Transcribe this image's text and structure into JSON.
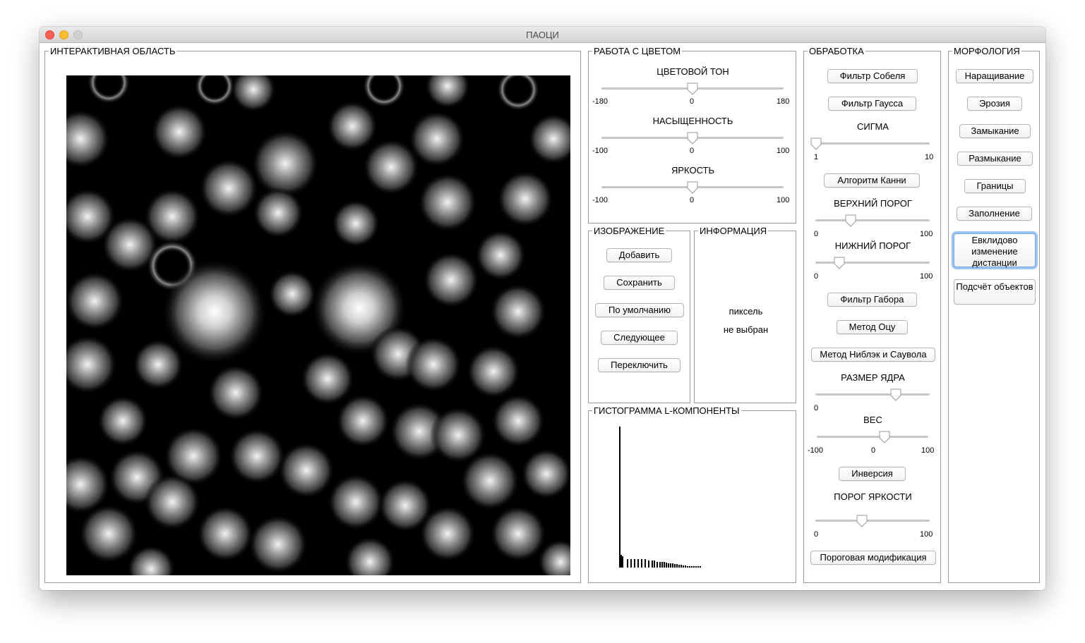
{
  "window": {
    "title": "ПАОЦИ"
  },
  "interactive": {
    "title": "ИНТЕРАКТИВНАЯ ОБЛАСТЬ"
  },
  "color": {
    "title": "РАБОТА С ЦВЕТОМ",
    "hue": {
      "label": "ЦВЕТОВОЙ ТОН",
      "min": "-180",
      "mid": "0",
      "max": "180",
      "value": 0
    },
    "saturation": {
      "label": "НАСЫЩЕННОСТЬ",
      "min": "-100",
      "mid": "0",
      "max": "100",
      "value": 0
    },
    "brightness": {
      "label": "ЯРКОСТЬ",
      "min": "-100",
      "mid": "0",
      "max": "100",
      "value": 0
    }
  },
  "image": {
    "title": "ИЗОБРАЖЕНИЕ",
    "add": "Добавить",
    "save": "Сохранить",
    "default": "По умолчанию",
    "next": "Следующее",
    "switch": "Переключить"
  },
  "info": {
    "title": "ИНФОРМАЦИЯ",
    "line1": "пиксель",
    "line2": "не выбран"
  },
  "histogram": {
    "title": "ГИСТОГРАММА L-КОМПОНЕНТЫ"
  },
  "processing": {
    "title": "ОБРАБОТКА",
    "sobel": "Фильтр Собеля",
    "gauss": "Фильтр Гаусса",
    "sigma": {
      "label": "СИГМА",
      "min": "1",
      "max": "10",
      "value": 1
    },
    "canny": "Алгоритм Канни",
    "upper": {
      "label": "ВЕРХНИЙ ПОРОГ",
      "min": "0",
      "max": "100",
      "value": 30
    },
    "lower": {
      "label": "НИЖНИЙ ПОРОГ",
      "min": "0",
      "max": "100",
      "value": 20
    },
    "gabor": "Фильтр Габора",
    "otsu": "Метод Оцу",
    "niblack": "Метод Ниблэк и Саувола",
    "kernel": {
      "label": "РАЗМЕР ЯДРА",
      "min": "0",
      "value": 70
    },
    "weight": {
      "label": "ВЕС",
      "min": "-100",
      "mid": "0",
      "max": "100",
      "value": 20
    },
    "inversion": "Инверсия",
    "brightness_threshold": {
      "label": "ПОРОГ ЯРКОСТИ",
      "min": "0",
      "max": "100",
      "value": 40
    },
    "threshold_mod": "Пороговая модификация"
  },
  "morphology": {
    "title": "МОРФОЛОГИЯ",
    "dilation": "Наращивание",
    "erosion": "Эрозия",
    "closing": "Замыкание",
    "opening": "Размыкание",
    "borders": "Границы",
    "fill": "Заполнение",
    "euclid": "Евклидово изменение дистанции",
    "count": "Подсчёт объектов"
  },
  "colors": {
    "accent": "#7aa9de",
    "track": "#c7c7c7",
    "border": "#9a9a9a"
  }
}
